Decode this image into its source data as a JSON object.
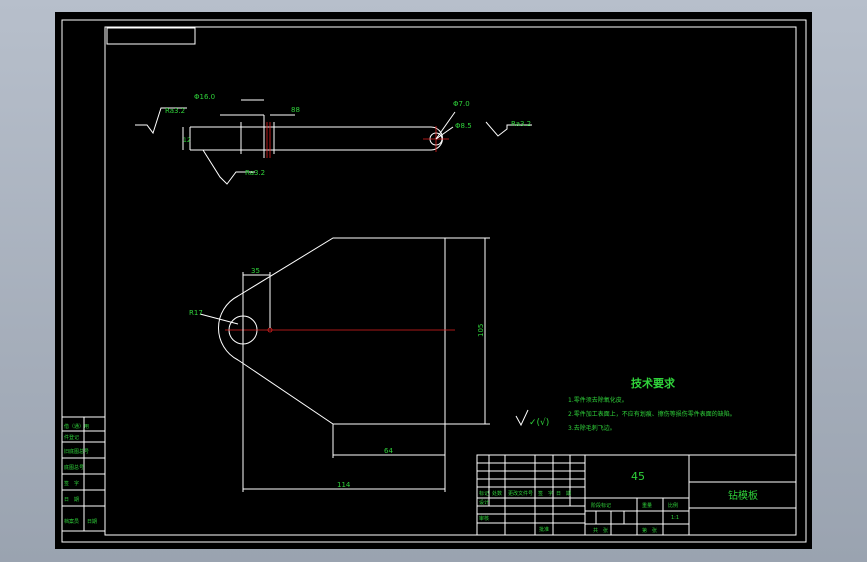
{
  "drawing": {
    "roughness_top_left": "Ra3.2",
    "roughness_top_right": "Ra3.2",
    "roughness_bottom": "Ra3.2",
    "dim_top_diameter": "Φ16.0",
    "dim_top_right": "88",
    "dim_hole_tol": "Φ7.0",
    "dim_hole_dia": "Φ8.5",
    "dim_left_thickness": "12",
    "dim_radius": "R17",
    "dim_offset": "35",
    "dim_height": "105",
    "dim_bottom_width": "64",
    "dim_total_width": "114"
  },
  "tech_requirements": {
    "title": "技术要求",
    "items": [
      "1.零件须去除氧化皮。",
      "2.零件加工表面上，不应有划痕、擦伤等损伤零件表面的缺陷。",
      "3.去除毛刺飞边。"
    ],
    "roughness_note": "✓(√)"
  },
  "side_table": {
    "rows": [
      "借（通）用",
      "件登记",
      "旧底图总号",
      "底图总号",
      "签　字",
      "日　期",
      "档案员",
      "日期"
    ]
  },
  "title_block": {
    "material": "45",
    "part_name": "钻模板",
    "scale": "1:1",
    "labels": {
      "mark": "标记",
      "count": "处数",
      "change_file": "更改文件号",
      "sign": "签　字",
      "date": "日　期",
      "design": "设计",
      "review": "审核",
      "stage": "阶段标记",
      "weight": "重量",
      "scale_label": "比例",
      "sheet_total": "共　张",
      "sheet_no": "第　张",
      "approve": "批准"
    }
  }
}
